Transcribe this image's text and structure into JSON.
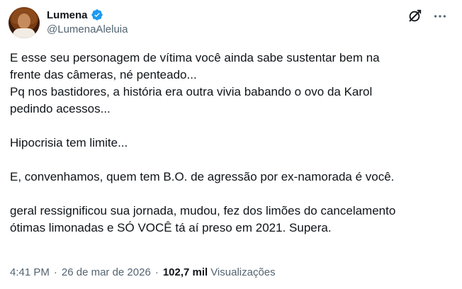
{
  "author": {
    "display_name": "Lumena",
    "handle": "@LumenaAleluia",
    "verified": true
  },
  "tweet": {
    "paragraphs": [
      "E esse seu personagem de vítima você ainda sabe sustentar bem na\nfrente das câmeras, né penteado...\nPq nos bastidores, a história era outra vivia babando o ovo da Karol\npedindo acessos...",
      "Hipocrisia tem limite...",
      "E, convenhamos, quem tem B.O. de agressão por ex-namorada é você.",
      "geral ressignificou sua jornada, mudou, fez dos limões do cancelamento\nótimas limonadas e SÓ VOCÊ tá aí preso em 2021. Supera."
    ]
  },
  "meta": {
    "time": "4:41 PM",
    "separator": "·",
    "date": "26 de mar de 2026",
    "views_count": "102,7 mil",
    "views_label": "Visualizações"
  },
  "colors": {
    "verified": "#1d9bf0",
    "secondary_text": "#536471",
    "primary_text": "#0f1419"
  },
  "icons": {
    "verified": "verified-badge-icon",
    "grok": "grok-icon",
    "more": "more-icon"
  }
}
